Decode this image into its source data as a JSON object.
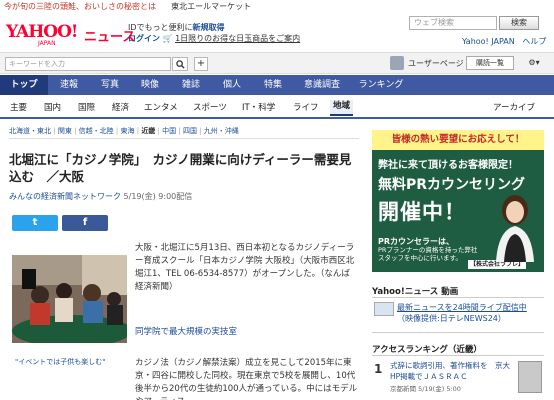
{
  "top_strip": {
    "promo_text": "今が旬の三陸の頭鮭、おいしさの秘密とは",
    "promo_link": "東北エールマーケット"
  },
  "header": {
    "logo": "YAHOO!",
    "logo_sub": "JAPAN",
    "section": "ニュース",
    "promo_line1_pre": "IDでもっと便利に",
    "promo_line1_link": "新規取得",
    "promo_line2_link": "ログイン",
    "promo_line2_rest": "1日限りのお得な日玉商品をご案内",
    "search_placeholder": "ウェブ検索",
    "search_button": "検索",
    "links": [
      "Yahoo! JAPAN",
      "ヘルプ"
    ]
  },
  "searchbar": {
    "keyword_placeholder": "キーワードを入力",
    "search_icon": "magnifier-icon",
    "plus_label": "+",
    "user_label": "ユーザーページ",
    "site_button": "購読一覧",
    "gear_icon": "gear-icon"
  },
  "categories": [
    "トップ",
    "速報",
    "写真",
    "映像",
    "雑誌",
    "個人",
    "特集",
    "意識調査",
    "ランキング"
  ],
  "subnav": {
    "items": [
      "主要",
      "国内",
      "国際",
      "経済",
      "エンタメ",
      "スポーツ",
      "IT・科学",
      "ライフ",
      "地域"
    ],
    "archive": "アーカイブ"
  },
  "regions": {
    "items": [
      "北海道・東北",
      "関東",
      "信越・北陸",
      "東海"
    ],
    "current": "近畿",
    "items_after": [
      "中国",
      "四国",
      "九州・沖縄"
    ]
  },
  "article": {
    "title": "北堀江に「カジノ学院」　カジノ開業に向けディーラー需要見込む　／大阪",
    "source": "みんなの経済新聞ネットワーク",
    "date": "5/19(金) 9:00配信",
    "twitter_label": "t",
    "facebook_label": "f",
    "caption": "\"イベントでは子供も楽しむ\"",
    "para1": "大阪・北堀江に5月13日、西日本初となるカジノディーラー育成スクール「日本カジノ学院 大阪校」（大阪市西区北堀江1、TEL 06-6534-8577）がオープンした。（なんば経済新聞）",
    "subhead": "同学院で最大規模の実技室",
    "para2": "カジノ法（カジノ解禁法案）成立を見こして2015年に東京・四谷に開校した同校。現在東京で5校を展開し、10代後半から20代の生徒約100人が通っている。中にはモデルやアーティス"
  },
  "ad": {
    "top": "皆様の熱い要望にお応えして！",
    "line1": "弊社に来て頂けるお客様限定！",
    "line2": "無料PRカウンセリング",
    "line3": "開催中！",
    "pr_heading": "PRカウンセラーは、",
    "pr_body": "PRプランナーの資格を持った弊社スタッフを中心に行います。",
    "company": "【株式会社ラプレ】"
  },
  "video": {
    "heading": "Yahoo!ニュース 動画",
    "title": "最新ニュースを24時間ライブ配信中",
    "subtitle": "（映像提供:日テレNEWS24）"
  },
  "access": {
    "heading": "アクセスランキング（近畿）",
    "rank": "1",
    "title": "式辞に歌詞引用、著作権料を　京大HP掲載でＪＡＳＲＡＣ",
    "source": "京都新聞",
    "date": "5/19(金) 5:00"
  },
  "colors": {
    "brand": "#ff0033",
    "nav": "#3f5aa3",
    "nav_active": "#203a7b",
    "link": "#1a4d99",
    "ad_bg": "#1f5d43"
  }
}
